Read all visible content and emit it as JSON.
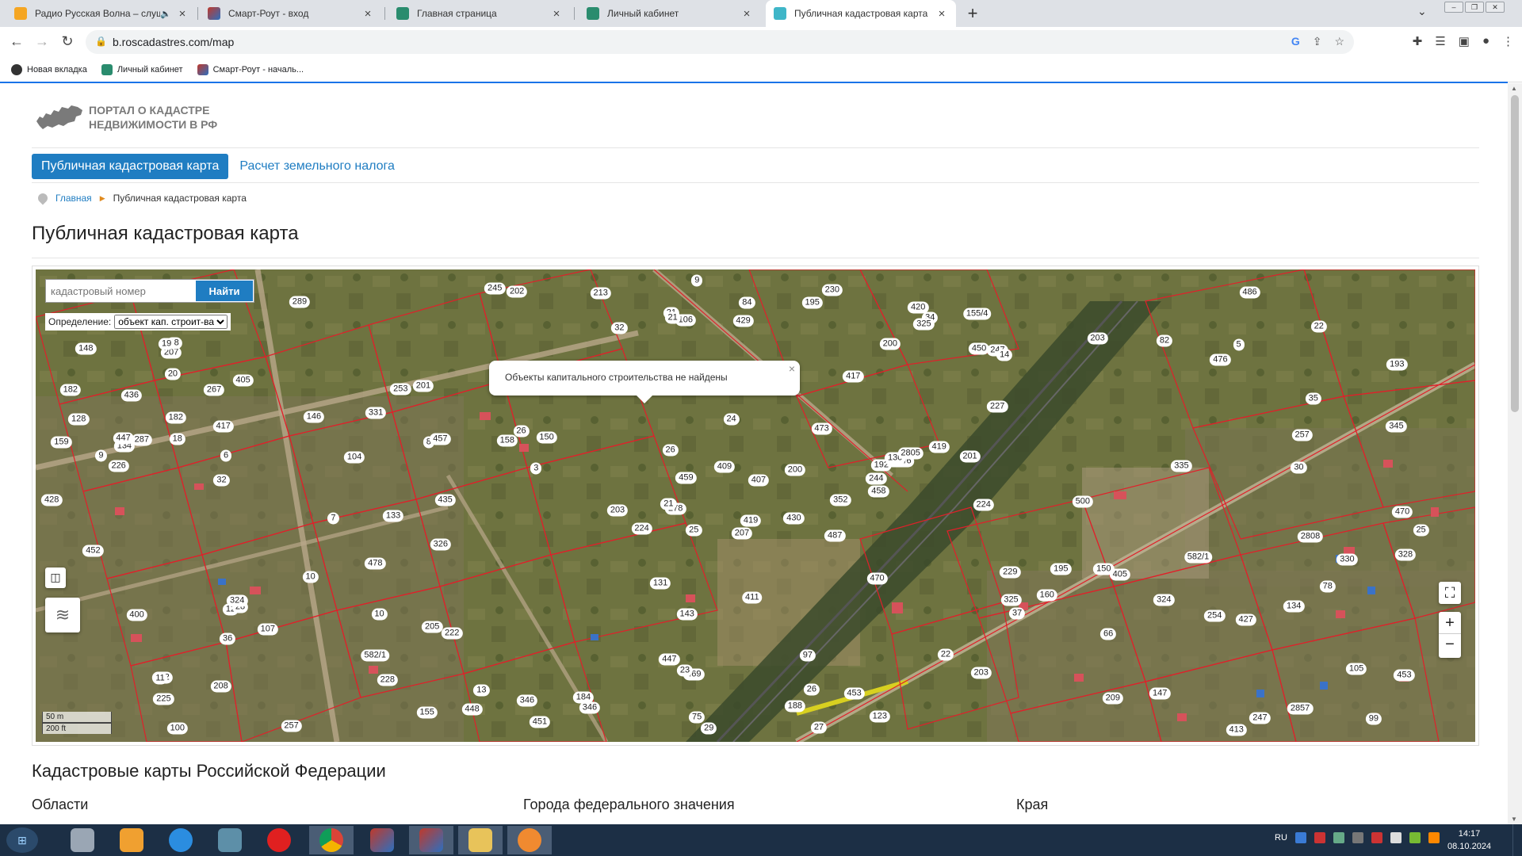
{
  "browser": {
    "tabs": [
      {
        "label": "Радио Русская Волна – слуша",
        "active": false
      },
      {
        "label": "Смарт-Роут - вход",
        "active": false
      },
      {
        "label": "Главная страница",
        "active": false
      },
      {
        "label": "Личный кабинет",
        "active": false
      },
      {
        "label": "Публичная кадастровая карта",
        "active": true
      }
    ],
    "new_tab": "+",
    "url": "b.roscadastres.com/map",
    "bookmarks": [
      {
        "label": "Новая вкладка"
      },
      {
        "label": "Личный кабинет"
      },
      {
        "label": "Смарт-Роут - началь..."
      }
    ]
  },
  "site": {
    "logo_line1": "Портал о кадастре",
    "logo_line2": "недвижимости в РФ",
    "nav": {
      "active": "Публичная кадастровая карта",
      "other": "Расчет земельного налога"
    },
    "breadcrumb": {
      "home": "Главная",
      "current": "Публичная кадастровая карта"
    },
    "page_title": "Публичная кадастровая карта"
  },
  "map": {
    "search_placeholder": "кадастровый номер",
    "search_button": "Найти",
    "definition_label": "Определение:",
    "definition_value": "объект кап. строит-ва",
    "popup_text": "Объекты капитального строительства не найдены",
    "popup_close": "×",
    "zoom_in": "+",
    "zoom_out": "−",
    "scale_m": "50 m",
    "scale_ft": "200 ft",
    "plot_numbers": [
      "207",
      "267",
      "278",
      "182",
      "192",
      "222",
      "155/4",
      "247",
      "352",
      "289",
      "99",
      "32",
      "193",
      "224",
      "227",
      "257",
      "473",
      "107",
      "150",
      "225",
      "228",
      "155/6",
      "405",
      "405",
      "106",
      "226",
      "229",
      "345",
      "21",
      "447",
      "459",
      "201",
      "203",
      "205",
      "247",
      "105",
      "150",
      "230",
      "158",
      "104",
      "37",
      "155",
      "159",
      "244",
      "100",
      "469",
      "458",
      "36",
      "35",
      "148",
      "160",
      "203",
      "582/1",
      "97",
      "5",
      "84",
      "435",
      "287",
      "331",
      "82",
      "34",
      "32",
      "409",
      "143",
      "346",
      "195",
      "8",
      "11",
      "146",
      "452",
      "26",
      "26",
      "200",
      "208",
      "224",
      "78",
      "75",
      "30",
      "411",
      "147",
      "27",
      "22",
      "21",
      "25",
      "201",
      "66",
      "407",
      "134",
      "134",
      "29",
      "450",
      "14",
      "7",
      "245",
      "470",
      "9",
      "10",
      "10",
      "13",
      "130",
      "476",
      "3",
      "2808",
      "207",
      "203",
      "202",
      "400",
      "25",
      "22",
      "213",
      "12",
      "486",
      "500",
      "478",
      "2857",
      "346",
      "335",
      "20",
      "28",
      "123",
      "457",
      "330",
      "324",
      "326",
      "324",
      "328",
      "26",
      "487",
      "6",
      "254",
      "430",
      "2805",
      "18",
      "184",
      "209",
      "23",
      "21",
      "257",
      "253",
      "447",
      "451",
      "582/1",
      "195",
      "24",
      "133",
      "417",
      "470",
      "429",
      "428",
      "9",
      "325",
      "182",
      "131",
      "453",
      "413",
      "427",
      "453",
      "128",
      "420",
      "419",
      "448",
      "200",
      "325",
      "182",
      "417",
      "436",
      "419",
      "188",
      "18",
      "19"
    ]
  },
  "sections": {
    "h2": "Кадастровые карты Российской Федерации",
    "col1": "Области",
    "col2": "Города федерального значения",
    "col3": "Края"
  },
  "taskbar": {
    "lang": "RU",
    "time": "14:17",
    "date": "08.10.2024"
  },
  "colors": {
    "accent": "#1f7dc2",
    "plot_border": "#e0202a",
    "taskbar": "#1c2f45"
  }
}
